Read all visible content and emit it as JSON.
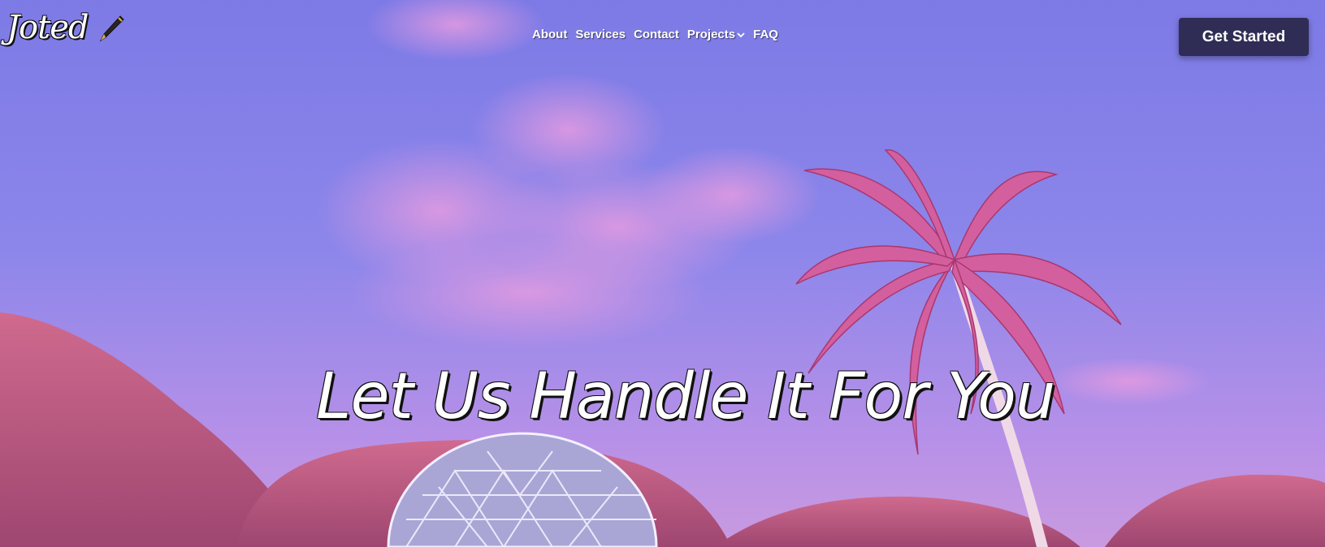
{
  "brand": {
    "name": "Joted",
    "logo_icon": "fountain-pen-icon"
  },
  "nav": {
    "links": [
      {
        "label": "About"
      },
      {
        "label": "Services"
      },
      {
        "label": "Contact"
      },
      {
        "label": "Projects",
        "has_dropdown": true,
        "icon": "chevron-down-icon"
      },
      {
        "label": "FAQ"
      }
    ],
    "cta_label": "Get Started"
  },
  "hero": {
    "headline_words": [
      "Let",
      "Us",
      "Handle",
      "It",
      "For",
      "You"
    ],
    "accent_word": "Us"
  },
  "colors": {
    "sky_top": "#7f78e4",
    "sky_bottom": "#c995d8",
    "hills": "#c25a86",
    "palm": "#d45f9e",
    "cta_bg": "#2f2d55",
    "accent_underline": "#2f7bdc"
  }
}
